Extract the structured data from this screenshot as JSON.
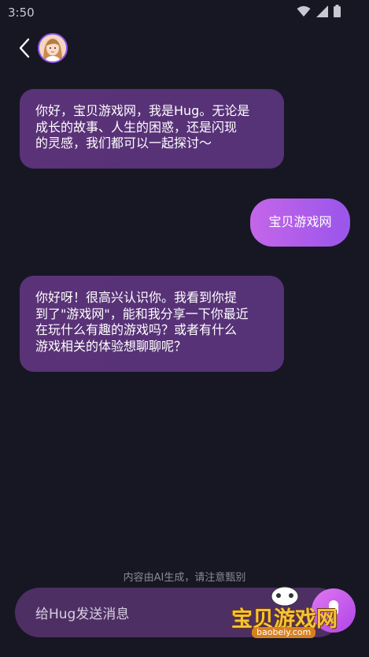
{
  "status": {
    "time": "3:50"
  },
  "header": {
    "avatar_icon": "girl-avatar-icon"
  },
  "messages": [
    {
      "role": "ai",
      "text": "你好，宝贝游戏网，我是Hug。无论是\n成长的故事、人生的困惑，还是闪现\n的灵感，我们都可以一起探讨～"
    },
    {
      "role": "user",
      "text": "宝贝游戏网"
    },
    {
      "role": "ai",
      "text": "你好呀！很高兴认识你。我看到你提\n到了\"游戏网\"，能和我分享一下你最近\n在玩什么有趣的游戏吗？或者有什么\n游戏相关的体验想聊聊呢？"
    }
  ],
  "footer": {
    "disclaimer": "内容由AI生成，请注意甄别",
    "input_placeholder": "给Hug发送消息"
  },
  "watermark": {
    "title": "宝贝游戏网",
    "url": "baobeiy.com"
  },
  "colors": {
    "background": "#171724",
    "ai_bubble": "#5a3277",
    "user_bubble": "#c466e9",
    "input_bg": "#4e2f63",
    "accent": "#b044e6"
  }
}
